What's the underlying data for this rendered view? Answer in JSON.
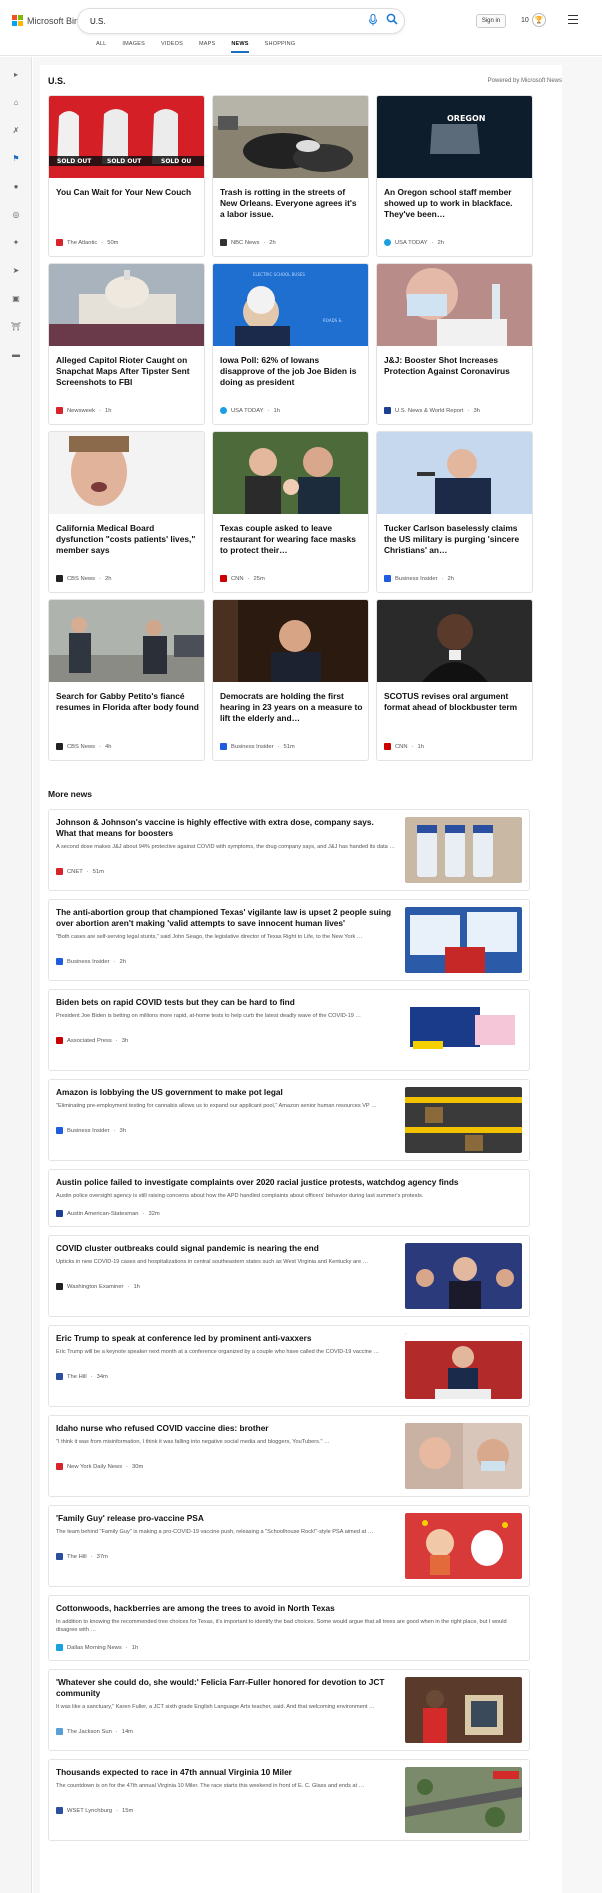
{
  "header": {
    "logo_text": "Microsoft Bing",
    "search_value": "U.S.",
    "signin_label": "Sign in",
    "rewards_count": "10",
    "tabs": [
      {
        "label": "ALL"
      },
      {
        "label": "IMAGES"
      },
      {
        "label": "VIDEOS"
      },
      {
        "label": "MAPS"
      },
      {
        "label": "NEWS"
      },
      {
        "label": "SHOPPING"
      }
    ],
    "active_tab": "NEWS"
  },
  "rail": {
    "icons": [
      "chevron-right-icon",
      "home-icon",
      "tools-icon",
      "flag-icon",
      "map-pin-icon",
      "globe-icon",
      "sparkle-icon",
      "rocket-icon",
      "film-icon",
      "bank-icon",
      "card-icon"
    ]
  },
  "top": {
    "section_title": "U.S.",
    "powered_by": "Powered by Microsoft News",
    "cards": [
      {
        "title": "You Can Wait for Your New Couch",
        "source": "The Atlantic",
        "time": "50m",
        "favicon_color": "#d9232a"
      },
      {
        "title": "Trash is rotting in the streets of New Orleans. Everyone agrees it's a labor issue.",
        "source": "NBC News",
        "time": "2h",
        "favicon_color": "#333333"
      },
      {
        "title": "An Oregon school staff member showed up to work in blackface. They've been…",
        "source": "USA TODAY",
        "time": "2h",
        "favicon_color": "#1a9fe0"
      },
      {
        "title": "Alleged Capitol Rioter Caught on Snapchat Maps After Tipster Sent Screenshots to FBI",
        "source": "Newsweek",
        "time": "1h",
        "favicon_color": "#d9232a"
      },
      {
        "title": "Iowa Poll: 62% of Iowans disapprove of the job Joe Biden is doing as president",
        "source": "USA TODAY",
        "time": "1h",
        "favicon_color": "#1a9fe0"
      },
      {
        "title": "J&J: Booster Shot Increases Protection Against Coronavirus",
        "source": "U.S. News & World Report",
        "time": "3h",
        "favicon_color": "#1c3f94"
      },
      {
        "title": "California Medical Board dysfunction \"costs patients' lives,\" member says",
        "source": "CBS News",
        "time": "2h",
        "favicon_color": "#222222"
      },
      {
        "title": "Texas couple asked to leave restaurant for wearing face masks to protect their…",
        "source": "CNN",
        "time": "25m",
        "favicon_color": "#cc0000"
      },
      {
        "title": "Tucker Carlson baselessly claims the US military is purging 'sincere Christians' an…",
        "source": "Business Insider",
        "time": "2h",
        "favicon_color": "#1f5ce0"
      },
      {
        "title": "Search for Gabby Petito's fiancé resumes in Florida after body found",
        "source": "CBS News",
        "time": "4h",
        "favicon_color": "#222222"
      },
      {
        "title": "Democrats are holding the first hearing in 23 years on a measure to lift the elderly and…",
        "source": "Business Insider",
        "time": "51m",
        "favicon_color": "#1f5ce0"
      },
      {
        "title": "SCOTUS revises oral argument format ahead of blockbuster term",
        "source": "CNN",
        "time": "1h",
        "favicon_color": "#cc0000"
      }
    ]
  },
  "more": {
    "section_title": "More news",
    "items": [
      {
        "title": "Johnson & Johnson's vaccine is highly effective with extra dose, company says. What that means for boosters",
        "snippet": "A second dose makes J&J about 94% protective against COVID with symptoms, the drug company says, and J&J has handed its data …",
        "source": "CNET",
        "time": "51m",
        "favicon_color": "#d9232a",
        "has_image": true
      },
      {
        "title": "The anti-abortion group that championed Texas' vigilante law is upset 2 people suing over abortion aren't making 'valid attempts to save innocent human lives'",
        "snippet": "\"Both cases are self-serving legal stunts,\" said John Seago, the legislative director of Texas Right to Life, to the New York …",
        "source": "Business Insider",
        "time": "2h",
        "favicon_color": "#1f5ce0",
        "has_image": true
      },
      {
        "title": "Biden bets on rapid COVID tests but they can be hard to find",
        "snippet": "President Joe Biden is betting on millions more rapid, at-home tests to help curb the latest deadly wave of the COVID-19 …",
        "source": "Associated Press",
        "time": "3h",
        "favicon_color": "#cc0000",
        "has_image": true
      },
      {
        "title": "Amazon is lobbying the US government to make pot legal",
        "snippet": "\"Eliminating pre-employment testing for cannabis allows us to expand our applicant pool,\" Amazon senior human resources VP …",
        "source": "Business Insider",
        "time": "3h",
        "favicon_color": "#1f5ce0",
        "has_image": true
      },
      {
        "title": "Austin police failed to investigate complaints over 2020 racial justice protests, watchdog agency finds",
        "snippet": "Austin police oversight agency is still raising concerns about how the APD handled complaints about officers' behavior during last summer's protests.",
        "source": "Austin American-Statesman",
        "time": "32m",
        "favicon_color": "#1c3f94",
        "has_image": false
      },
      {
        "title": "COVID cluster outbreaks could signal pandemic is nearing the end",
        "snippet": "Upticks in new COVID-19 cases and hospitalizations in central southeastern states such as West Virginia and Kentucky are …",
        "source": "Washington Examiner",
        "time": "1h",
        "favicon_color": "#222222",
        "has_image": true
      },
      {
        "title": "Eric Trump to speak at conference led by prominent anti-vaxxers",
        "snippet": "Eric Trump will be a keynote speaker next month at a conference organized by a couple who have called the COVID-19 vaccine …",
        "source": "The Hill",
        "time": "34m",
        "favicon_color": "#2a4fa0",
        "has_image": true
      },
      {
        "title": "Idaho nurse who refused COVID vaccine dies: brother",
        "snippet": "\"I think it was from misinformation, I think it was falling into negative social media and bloggers, YouTubers.\" …",
        "source": "New York Daily News",
        "time": "30m",
        "favicon_color": "#d9232a",
        "has_image": true
      },
      {
        "title": "'Family Guy' release pro-vaccine PSA",
        "snippet": "The team behind \"Family Guy\" is making a pro-COVID-19 vaccine push, releasing a \"Schoolhouse Rock!\"-style PSA aimed at …",
        "source": "The Hill",
        "time": "37m",
        "favicon_color": "#2a4fa0",
        "has_image": true
      },
      {
        "title": "Cottonwoods, hackberries are among the trees to avoid in North Texas",
        "snippet": "In addition to knowing the recommended tree choices for Texas, it's important to identify the bad choices. Some would argue that all trees are good when in the right place, but I would disagree with …",
        "source": "Dallas Morning News",
        "time": "1h",
        "favicon_color": "#1a9fe0",
        "has_image": false
      },
      {
        "title": "'Whatever she could do, she would:' Felicia Farr-Fuller honored for devotion to JCT community",
        "snippet": "It was like a sanctuary,\" Karen Fuller, a JCT sixth grade English Language Arts teacher, said. And that welcoming environment …",
        "source": "The Jackson Sun",
        "time": "14m",
        "favicon_color": "#5aa0d8",
        "has_image": true
      },
      {
        "title": "Thousands expected to race in 47th annual Virginia 10 Miler",
        "snippet": "The countdown is on for the 47th annual Virginia 10 Miler. The race starts this weekend in front of E. C. Glass and ends at …",
        "source": "WSET Lynchburg",
        "time": "15m",
        "favicon_color": "#2a4fa0",
        "has_image": true
      }
    ]
  }
}
